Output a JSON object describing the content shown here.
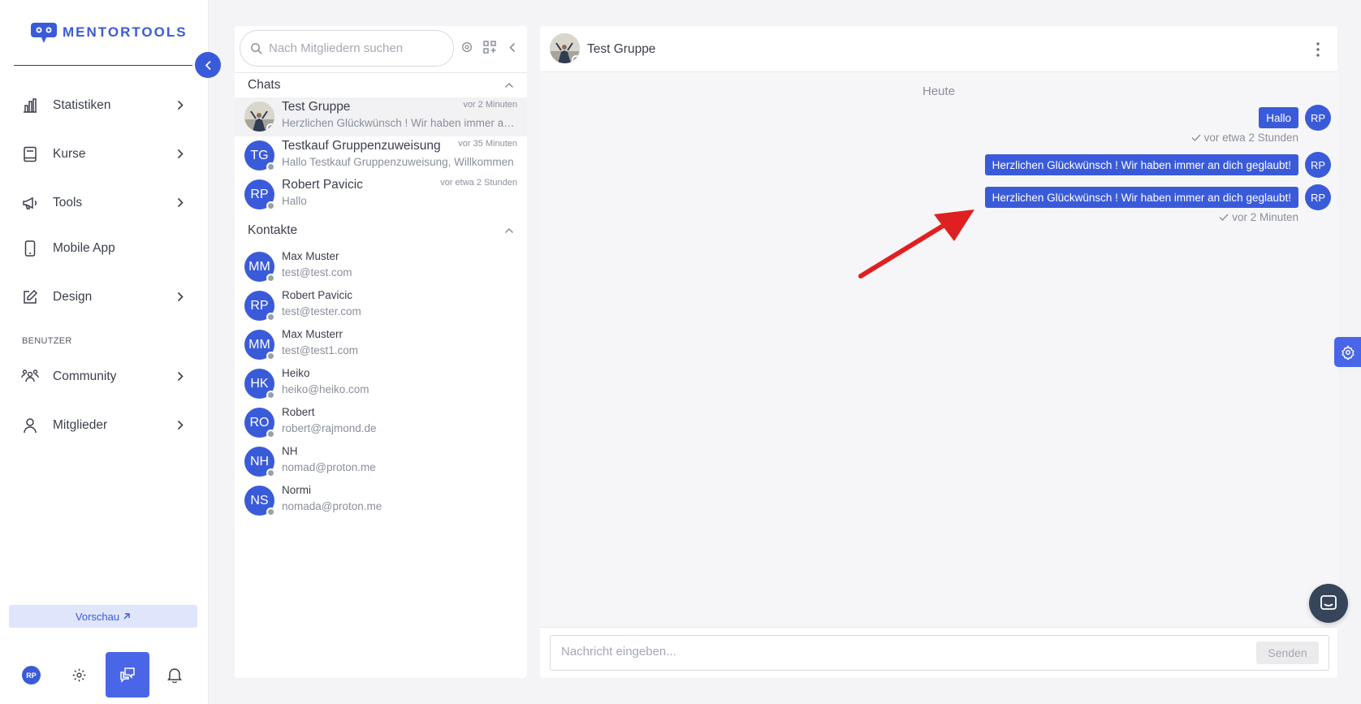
{
  "brand": {
    "name": "MENTORTOOLS",
    "color": "#3a5bd9"
  },
  "sidebar": {
    "items": [
      {
        "label": "Statistiken",
        "icon": "bar-chart-icon",
        "chevron": true
      },
      {
        "label": "Kurse",
        "icon": "book-icon",
        "chevron": true
      },
      {
        "label": "Tools",
        "icon": "megaphone-icon",
        "chevron": true
      },
      {
        "label": "Mobile App",
        "icon": "phone-icon",
        "chevron": false
      },
      {
        "label": "Design",
        "icon": "edit-icon",
        "chevron": true
      }
    ],
    "section_label": "BENUTZER",
    "user_items": [
      {
        "label": "Community",
        "icon": "community-icon",
        "chevron": true
      },
      {
        "label": "Mitglieder",
        "icon": "user-icon",
        "chevron": true
      }
    ],
    "preview_label": "Vorschau",
    "user_initials": "RP"
  },
  "list_panel": {
    "search_placeholder": "Nach Mitgliedern suchen",
    "chats_label": "Chats",
    "contacts_label": "Kontakte",
    "chats": [
      {
        "name": "Test Gruppe",
        "time": "vor 2 Minuten",
        "preview": "Herzlichen Glückwünsch ! Wir haben immer an dich geglaubt!",
        "initials": "",
        "photo": true,
        "active": true
      },
      {
        "name": "Testkauf Gruppenzuweisung",
        "time": "vor 35 Minuten",
        "preview": "Hallo Testkauf Gruppenzuweisung, Willkommen",
        "initials": "TG",
        "photo": false,
        "active": false
      },
      {
        "name": "Robert Pavicic",
        "time": "vor etwa 2 Stunden",
        "preview": "Hallo",
        "initials": "RP",
        "photo": false,
        "active": false
      }
    ],
    "contacts": [
      {
        "name": "Max Muster",
        "email": "test@test.com",
        "initials": "MM"
      },
      {
        "name": "Robert Pavicic",
        "email": "test@tester.com",
        "initials": "RP"
      },
      {
        "name": "Max Musterr",
        "email": "test@test1.com",
        "initials": "MM"
      },
      {
        "name": "Heiko",
        "email": "heiko@heiko.com",
        "initials": "HK"
      },
      {
        "name": "Robert",
        "email": "robert@rajmond.de",
        "initials": "RO"
      },
      {
        "name": "NH",
        "email": "nomad@proton.me",
        "initials": "NH"
      },
      {
        "name": "Normi",
        "email": "nomada@proton.me",
        "initials": "NS"
      }
    ]
  },
  "conversation": {
    "title": "Test Gruppe",
    "day_label": "Heute",
    "messages": [
      {
        "text": "Hallo",
        "initials": "RP",
        "meta": "vor etwa 2 Stunden"
      },
      {
        "text": "Herzlichen Glückwünsch ! Wir haben immer an dich geglaubt!",
        "initials": "RP",
        "meta": ""
      },
      {
        "text": "Herzlichen Glückwünsch ! Wir haben immer an dich geglaubt!",
        "initials": "RP",
        "meta": "vor 2 Minuten"
      }
    ],
    "composer_placeholder": "Nachricht eingeben...",
    "send_label": "Senden"
  },
  "colors": {
    "accent": "#3a5bd9",
    "annotation_arrow": "#e02020",
    "status_offline": "#9aa0a6"
  }
}
